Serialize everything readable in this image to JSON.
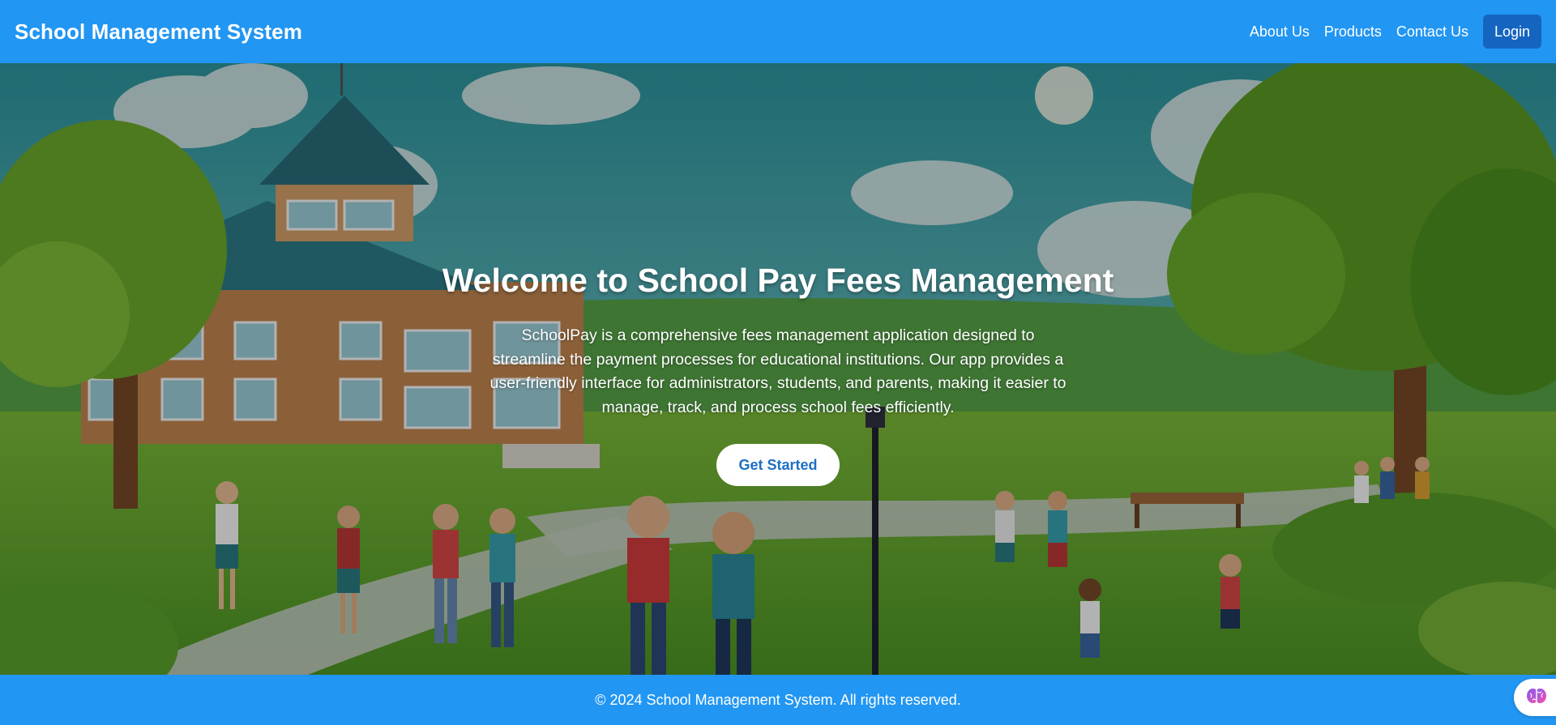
{
  "header": {
    "brand": "School Management System",
    "nav": {
      "about": "About Us",
      "products": "Products",
      "contact": "Contact Us",
      "login": "Login"
    }
  },
  "hero": {
    "title": "Welcome to School Pay Fees Management",
    "description": "SchoolPay is a comprehensive fees management application designed to streamline the payment processes for educational institutions. Our app provides a user-friendly interface for administrators, students, and parents, making it easier to manage, track, and process school fees efficiently.",
    "cta_label": "Get Started"
  },
  "footer": {
    "copyright": "© 2024 School Management System. All rights reserved."
  },
  "icons": {
    "assistant": "brain-icon"
  },
  "colors": {
    "primary": "#2196f3",
    "login_bg": "#1565c0",
    "cta_text": "#1e6fc4"
  }
}
